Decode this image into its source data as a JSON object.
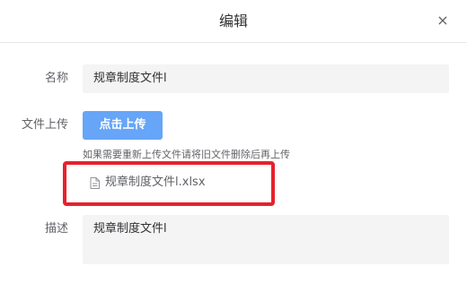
{
  "dialog": {
    "title": "编辑",
    "close_glyph": "×"
  },
  "form": {
    "name": {
      "label": "名称",
      "value": "规章制度文件l"
    },
    "upload": {
      "label": "文件上传",
      "button_label": "点击上传",
      "tip": "如果需要重新上传文件请将旧文件删除后再上传",
      "file_icon": "document-icon",
      "file_name": "规章制度文件l.xlsx"
    },
    "description": {
      "label": "描述",
      "value": "规章制度文件l"
    }
  },
  "colors": {
    "primary_button": "#66a5f7",
    "highlight_border": "#e8212c",
    "input_background": "#f4f4f5"
  }
}
